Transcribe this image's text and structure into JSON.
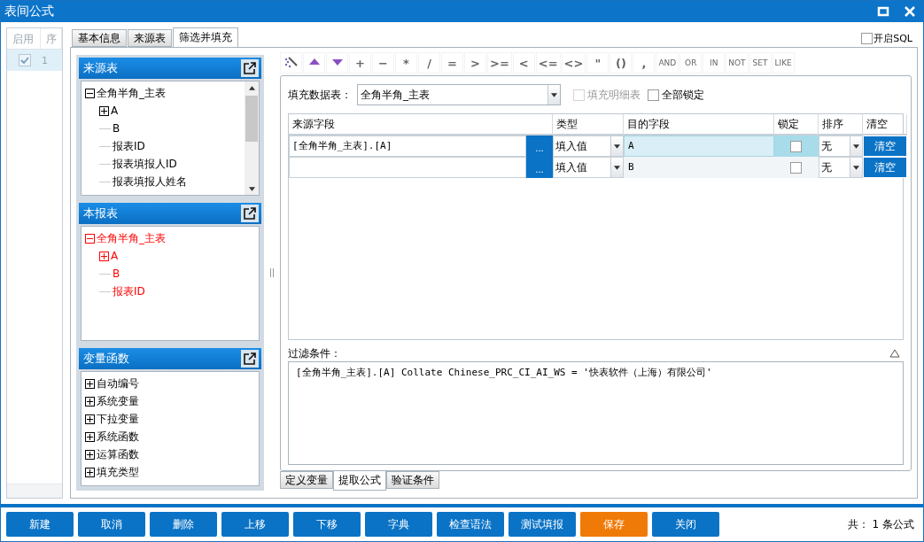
{
  "window": {
    "title": "表间公式"
  },
  "record_list": {
    "columns": [
      "启用",
      "序"
    ],
    "rows": [
      {
        "enabled": true,
        "number": "1"
      }
    ]
  },
  "tabs": [
    {
      "label": "基本信息",
      "selected": false
    },
    {
      "label": "来源表",
      "selected": false
    },
    {
      "label": "筛选并填充",
      "selected": true
    }
  ],
  "open_sql": {
    "label": "开启SQL",
    "checked": false
  },
  "panels": [
    {
      "title": "来源表",
      "color": "#000000",
      "scroll": true,
      "tree": [
        {
          "label": "全角半角_主表",
          "expanded": true,
          "children": [
            {
              "label": "A",
              "expanded": false
            },
            {
              "label": "B"
            },
            {
              "label": "报表ID"
            },
            {
              "label": "报表填报人ID"
            },
            {
              "label": "报表填报人姓名"
            }
          ]
        }
      ]
    },
    {
      "title": "本报表",
      "color": "#ff0000",
      "scroll": false,
      "tree": [
        {
          "label": "全角半角_主表",
          "expanded": true,
          "children": [
            {
              "label": "A",
              "expanded": false
            },
            {
              "label": "B"
            },
            {
              "label": "报表ID"
            }
          ]
        }
      ]
    },
    {
      "title": "变量函数",
      "color": "#000000",
      "scroll": false,
      "tree": [
        {
          "label": "自动编号",
          "expanded": false
        },
        {
          "label": "系统变量",
          "expanded": false
        },
        {
          "label": "下拉变量",
          "expanded": false
        },
        {
          "label": "系统函数",
          "expanded": false
        },
        {
          "label": "运算函数",
          "expanded": false
        },
        {
          "label": "填充类型",
          "expanded": false
        }
      ]
    }
  ],
  "toolbar": [
    {
      "kind": "wand"
    },
    {
      "kind": "up"
    },
    {
      "kind": "down"
    },
    {
      "kind": "text",
      "label": "+"
    },
    {
      "kind": "text",
      "label": "−"
    },
    {
      "kind": "text",
      "label": "*"
    },
    {
      "kind": "text",
      "label": "/"
    },
    {
      "kind": "text",
      "label": "="
    },
    {
      "kind": "text",
      "label": ">"
    },
    {
      "kind": "text",
      "label": ">="
    },
    {
      "kind": "text",
      "label": "<"
    },
    {
      "kind": "text",
      "label": "<="
    },
    {
      "kind": "text",
      "label": "<>"
    },
    {
      "kind": "text",
      "label": "\""
    },
    {
      "kind": "text",
      "label": "()"
    },
    {
      "kind": "text",
      "label": ","
    },
    {
      "kind": "word",
      "label": "AND"
    },
    {
      "kind": "word",
      "label": "OR"
    },
    {
      "kind": "word",
      "label": "IN"
    },
    {
      "kind": "word",
      "label": "NOT"
    },
    {
      "kind": "word",
      "label": "SET"
    },
    {
      "kind": "word",
      "label": "LIKE"
    }
  ],
  "fill": {
    "label": "填充数据表：",
    "value": "全角半角_主表",
    "detail": {
      "label": "填充明细表",
      "checked": false,
      "disabled": true
    },
    "lock_all": {
      "label": "全部锁定",
      "checked": false,
      "disabled": false
    }
  },
  "grid": {
    "columns": [
      "来源字段",
      "类型",
      "目的字段",
      "锁定",
      "排序",
      "清空"
    ],
    "rows": [
      {
        "source": "[全角半角_主表].[A]",
        "picker": "...",
        "type": "填入值",
        "target": "A",
        "locked": false,
        "sort": "无",
        "clear": "清空",
        "selected": true
      },
      {
        "source": "",
        "picker": "...",
        "type": "填入值",
        "target": "B",
        "locked": false,
        "sort": "无",
        "clear": "清空",
        "selected": false
      }
    ]
  },
  "filter": {
    "label": "过滤条件：",
    "text": "[全角半角_主表].[A] Collate Chinese_PRC_CI_AI_WS = '快表软件（上海）有限公司'"
  },
  "bottom_tabs": [
    {
      "label": "定义变量",
      "selected": false
    },
    {
      "label": "提取公式",
      "selected": true
    },
    {
      "label": "验证条件",
      "selected": false
    }
  ],
  "buttons": [
    {
      "label": "新建",
      "highlighted": false
    },
    {
      "label": "取消",
      "highlighted": false
    },
    {
      "label": "删除",
      "highlighted": false
    },
    {
      "label": "上移",
      "highlighted": false
    },
    {
      "label": "下移",
      "highlighted": false
    },
    {
      "label": "字典",
      "highlighted": false
    },
    {
      "label": "检查语法",
      "highlighted": false
    },
    {
      "label": "测试填报",
      "highlighted": false
    },
    {
      "label": "保存",
      "highlighted": true
    },
    {
      "label": "关闭",
      "highlighted": false
    }
  ],
  "footer": {
    "prefix": "共：",
    "count": "1",
    "suffix": "条公式"
  }
}
